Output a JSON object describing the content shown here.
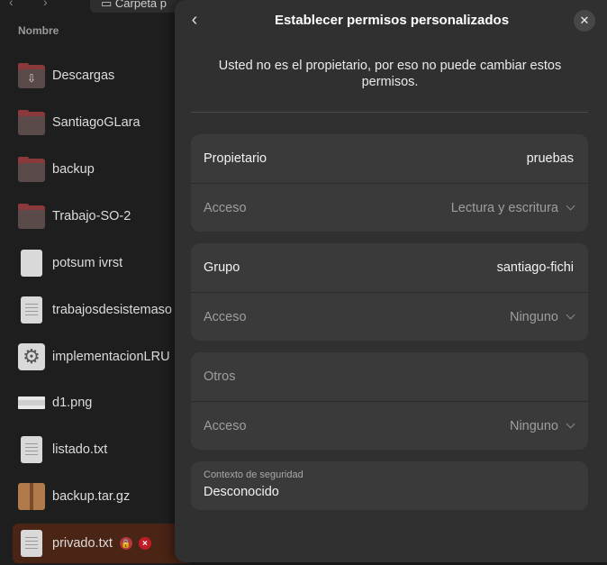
{
  "file_manager": {
    "path_label": "Carpeta p",
    "column_header": "Nombre",
    "files": [
      {
        "name": "Descargas",
        "icon": "downloads-folder-icon",
        "type": "download-folder"
      },
      {
        "name": "SantiagoGLara",
        "icon": "folder-icon",
        "type": "folder"
      },
      {
        "name": "backup",
        "icon": "folder-icon",
        "type": "folder"
      },
      {
        "name": "Trabajo-SO-2",
        "icon": "folder-icon",
        "type": "folder"
      },
      {
        "name": "potsum ivrst",
        "icon": "blank-file-icon",
        "type": "blank"
      },
      {
        "name": "trabajosdesistemaso",
        "icon": "text-file-icon",
        "type": "text"
      },
      {
        "name": "implementacionLRU",
        "icon": "executable-gear-icon",
        "type": "gear"
      },
      {
        "name": "d1.png",
        "icon": "image-file-icon",
        "type": "image"
      },
      {
        "name": "listado.txt",
        "icon": "text-file-icon",
        "type": "text"
      },
      {
        "name": "backup.tar.gz",
        "icon": "archive-icon",
        "type": "archive"
      },
      {
        "name": "privado.txt",
        "icon": "text-file-icon",
        "type": "text",
        "selected": true
      }
    ]
  },
  "dialog": {
    "title": "Establecer permisos personalizados",
    "back_icon": "chevron-left-icon",
    "close_icon": "close-icon",
    "notice": "Usted no es el propietario, por eso no puede cambiar estos permisos.",
    "owner": {
      "label": "Propietario",
      "value": "pruebas",
      "access_label": "Acceso",
      "access_value": "Lectura y escritura"
    },
    "group": {
      "label": "Grupo",
      "value": "santiago-fichi",
      "access_label": "Acceso",
      "access_value": "Ninguno"
    },
    "others": {
      "label": "Otros",
      "access_label": "Acceso",
      "access_value": "Ninguno"
    },
    "security": {
      "caption": "Contexto de seguridad",
      "value": "Desconocido"
    }
  },
  "colors": {
    "dialog_bg": "#303030",
    "card_bg": "#3a3a3a",
    "selected_row": "#4a2415",
    "folder": "#8a3a3a"
  }
}
